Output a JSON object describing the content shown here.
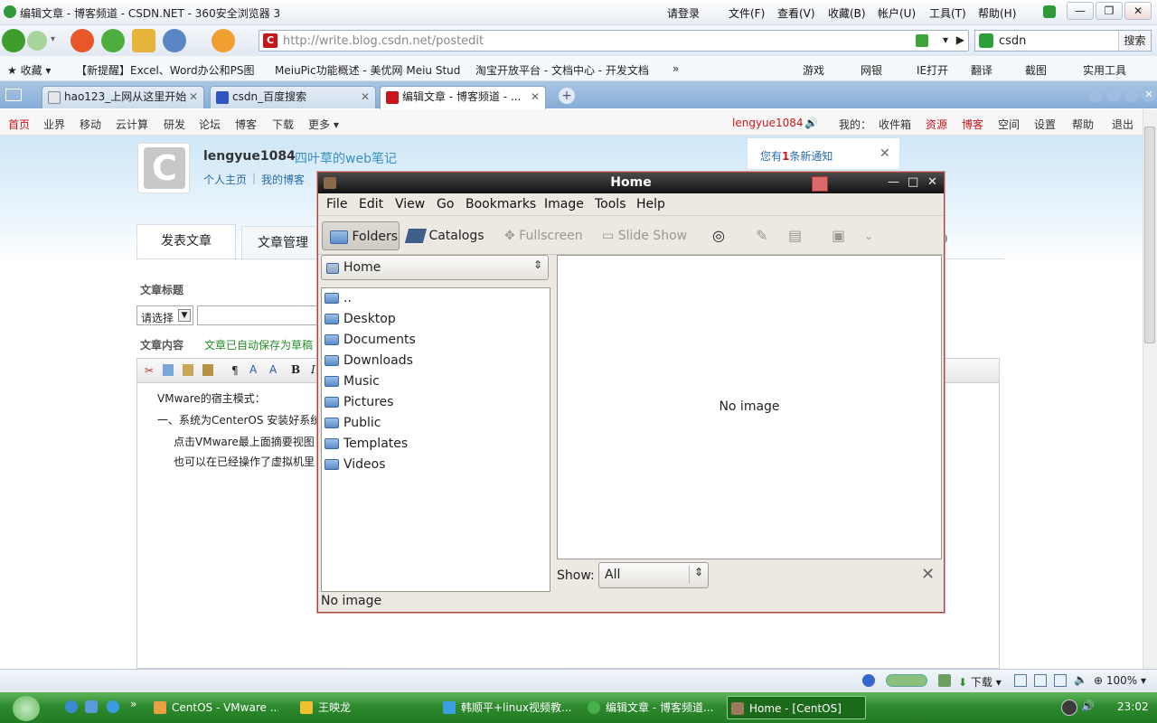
{
  "browser": {
    "title": "编辑文章 - 博客频道 - CSDN.NET - 360安全浏览器 3",
    "menu": [
      "请登录",
      "文件(F)",
      "查看(V)",
      "收藏(B)",
      "帐户(U)",
      "工具(T)",
      "帮助(H)"
    ],
    "url": "http://write.blog.csdn.net/postedit",
    "search_value": "csdn",
    "search_button": "搜索",
    "favorites": [
      "收藏",
      "【新提醒】Excel、Word办公和PS图",
      "MeiuPic功能概述 - 美优网 Meiu Stud",
      "淘宝开放平台 - 文档中心 - 开发文档"
    ],
    "favorites_more": "»",
    "fav_right": [
      "游戏",
      "网银",
      "IE打开",
      "翻译",
      "截图",
      "实用工具"
    ],
    "tabs": [
      "hao123_上网从这里开始",
      "csdn_百度搜索",
      "编辑文章 - 博客频道 - ..."
    ],
    "status_download": "下载",
    "status_zoom": "100%"
  },
  "csdn": {
    "nav": [
      "首页",
      "业界",
      "移动",
      "云计算",
      "研发",
      "论坛",
      "博客",
      "下载",
      "更多"
    ],
    "username": "lengyue1084",
    "my_label": "我的：",
    "right_links": [
      "收件箱",
      "资源",
      "博客",
      "空间",
      "设置",
      "帮助",
      "退出"
    ],
    "blog_user": "lengyue1084",
    "blog_name": "四叶草的web笔记",
    "home_link": "个人主页",
    "myblog_link": "我的博客",
    "notice": "您有1条新通知",
    "notice_pre": "您有",
    "notice_num": "1",
    "notice_post": "条新通知",
    "tab_publish": "发表文章",
    "tab_manage": "文章管理",
    "label_title": "文章标题",
    "select_default": "请选择",
    "label_content": "文章内容",
    "autosave": "文章已自动保存为草稿",
    "editor_lines": [
      "VMware的宿主模式：",
      "一、系统为CenterOS 安装好系统",
      "点击VMware最上面摘要视图",
      "也可以在已经操作了虚拟机里"
    ]
  },
  "gthumb": {
    "title": "Home",
    "menu": [
      "File",
      "Edit",
      "View",
      "Go",
      "Bookmarks",
      "Image",
      "Tools",
      "Help"
    ],
    "toolbar": {
      "folders": "Folders",
      "catalogs": "Catalogs",
      "fullscreen": "Fullscreen",
      "slideshow": "Slide Show"
    },
    "location": "Home",
    "folders": [
      "..",
      "Desktop",
      "Documents",
      "Downloads",
      "Music",
      "Pictures",
      "Public",
      "Templates",
      "Videos"
    ],
    "viewer_text": "No image",
    "show_label": "Show:",
    "show_value": "All",
    "status": "No image"
  },
  "taskbar": {
    "items": [
      "CentOS - VMware ...",
      "王映龙",
      "韩顺平+linux视频教...",
      "编辑文章 - 博客频道...",
      "Home  - [CentOS]"
    ],
    "clock": "23:02"
  },
  "colors": {
    "csdn_red": "#c8161d",
    "taskbar_green": "#2e8a2e",
    "gthumb_title": "#121212"
  }
}
